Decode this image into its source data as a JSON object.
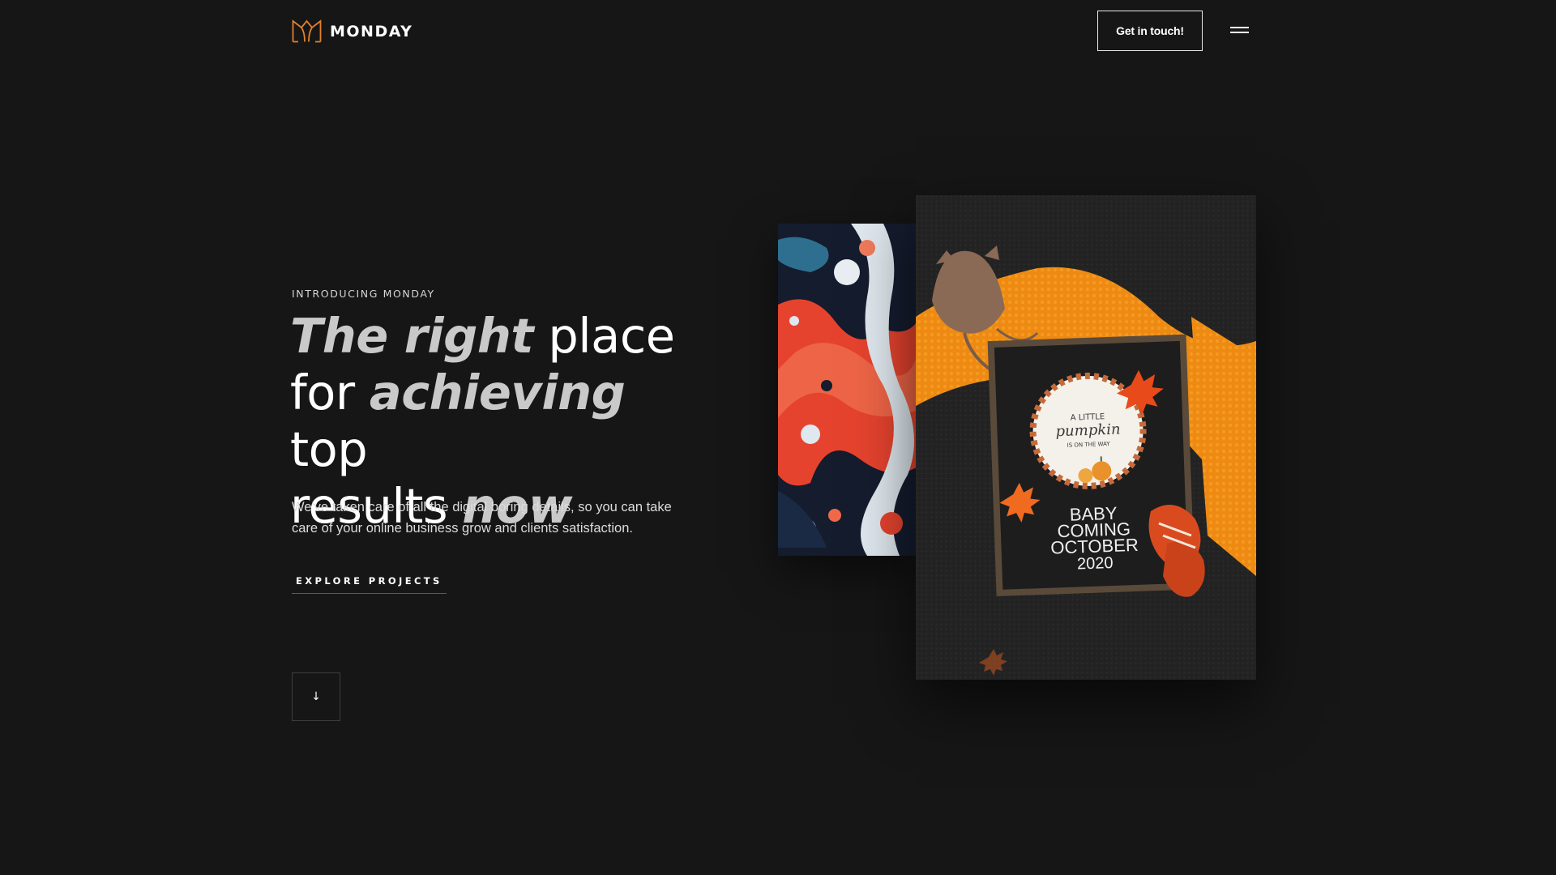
{
  "brand": {
    "name": "MONDAY",
    "accent": "#e0812e"
  },
  "header": {
    "cta_label": "Get in touch!",
    "menu_icon": "hamburger-menu-icon"
  },
  "hero": {
    "eyebrow": "INTRODUCING MONDAY",
    "headline": [
      {
        "text": "The right",
        "emphasis": true
      },
      {
        "text": " place",
        "emphasis": false
      },
      {
        "text": "for ",
        "emphasis": false
      },
      {
        "text": "achieving",
        "emphasis": true
      },
      {
        "text": " top",
        "emphasis": false
      },
      {
        "text": "results ",
        "emphasis": false
      },
      {
        "text": "now",
        "emphasis": true
      }
    ],
    "description": "We've taken care of all the digital boring details, so you can take care of your online business grow and clients satisfaction.",
    "explore_label": "EXPLORE PROJECTS",
    "scroll_icon": "↓"
  },
  "showcase": {
    "board_lines": [
      "A LITTLE",
      "pumpkin",
      "IS ON THE WAY"
    ],
    "board_message": [
      "BABY",
      "COMING",
      "OCTOBER",
      "2020"
    ]
  }
}
